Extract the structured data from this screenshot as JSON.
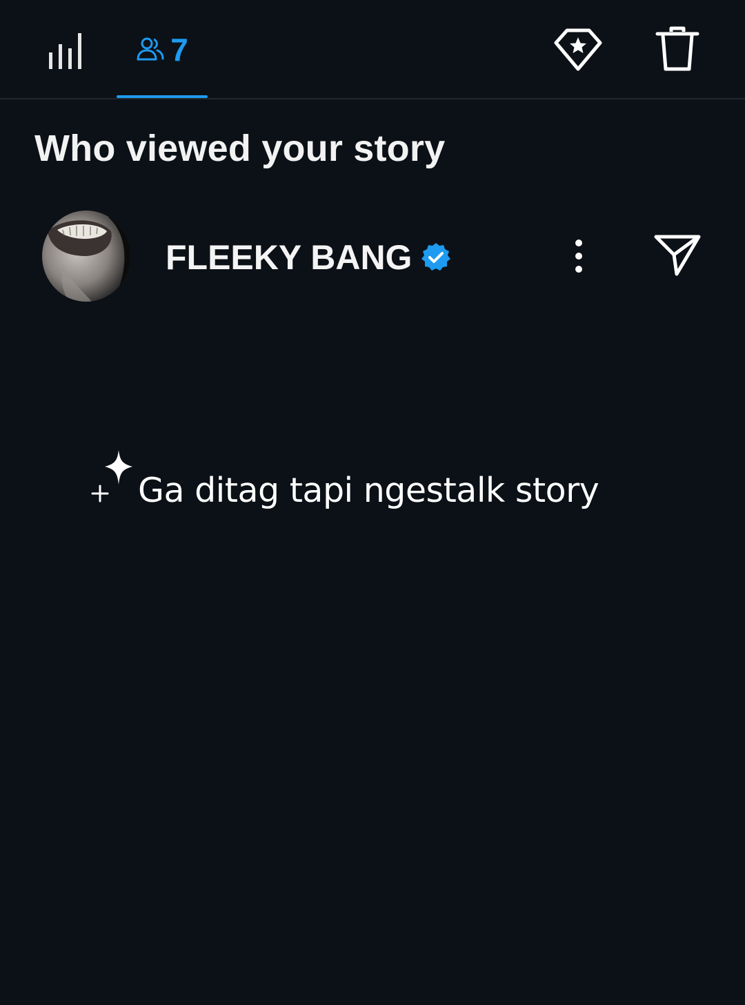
{
  "tabs": {
    "insights": {
      "icon": "bar-chart-icon"
    },
    "viewers": {
      "icon": "people-icon",
      "count": "7"
    }
  },
  "actions": {
    "highlight": {
      "icon": "diamond-star-icon"
    },
    "delete": {
      "icon": "trash-icon"
    }
  },
  "section_title": "Who viewed your story",
  "viewers": [
    {
      "name": "FLEEKY BANG",
      "verified": true,
      "more_icon": "more-vertical-icon",
      "send_icon": "send-icon"
    }
  ],
  "caption": {
    "text": "Ga ditag tapi ngestalk story",
    "icon": "sparkle-icon"
  },
  "colors": {
    "background": "#0c1117",
    "accent": "#1e9bf0",
    "divider": "#202730",
    "text": "#ffffff"
  }
}
